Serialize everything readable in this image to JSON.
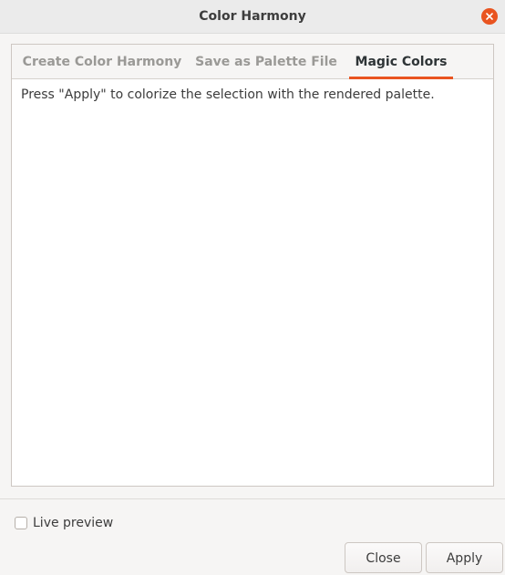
{
  "window": {
    "title": "Color Harmony"
  },
  "tabs": [
    {
      "label": "Create Color Harmony",
      "active": false
    },
    {
      "label": "Save as Palette File",
      "active": false
    },
    {
      "label": "Magic Colors",
      "active": true
    }
  ],
  "page": {
    "text": "Press \"Apply\" to colorize the selection with the rendered palette."
  },
  "options": {
    "live_preview_label": "Live preview",
    "live_preview_checked": false
  },
  "buttons": {
    "close_label": "Close",
    "apply_label": "Apply"
  },
  "colors": {
    "accent": "#e95420",
    "titlebar": "#ebebeb",
    "window_bg": "#f6f5f4",
    "inactive_tab_text": "#9a9996",
    "active_tab_text": "#2e3436"
  },
  "icons": {
    "window_close": "close-icon"
  }
}
